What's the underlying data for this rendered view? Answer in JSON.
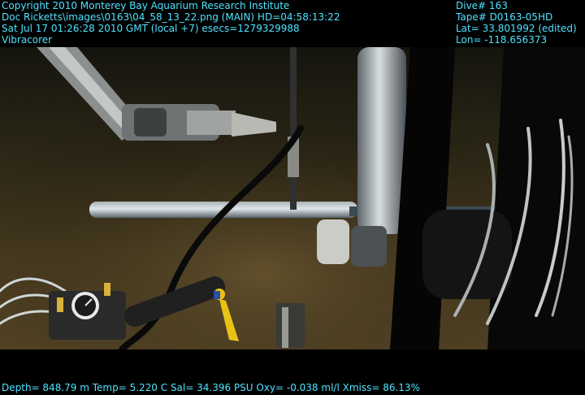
{
  "overlay": {
    "top_left": [
      "Copyright 2010 Monterey Bay Aquarium Research Institute",
      "Doc Ricketts\\images\\0163\\04_58_13_22.png (MAIN)  HD=04:58:13:22",
      "Sat Jul 17 01:26:28 2010 GMT (local +7)  esecs=1279329988",
      "Vibracorer"
    ],
    "top_right": [
      "Dive# 163",
      "Tape# D0163-05HD",
      "Lat= 33.801992 (edited)",
      "Lon= -118.656373"
    ],
    "bottom": "Depth= 848.79 m  Temp= 5.220 C  Sal= 34.396 PSU  Oxy= -0.038 ml/l  Xmiss= 86.13%"
  },
  "colors": {
    "overlay_text": "#4fe3ff",
    "seafloor": "#4a3c20",
    "water": "#0c0d0a"
  },
  "scene_description_icons": [
    "robotic-arm",
    "vibracorer-tubes",
    "sediment-core-pipe",
    "instrument-gauge",
    "cables"
  ]
}
